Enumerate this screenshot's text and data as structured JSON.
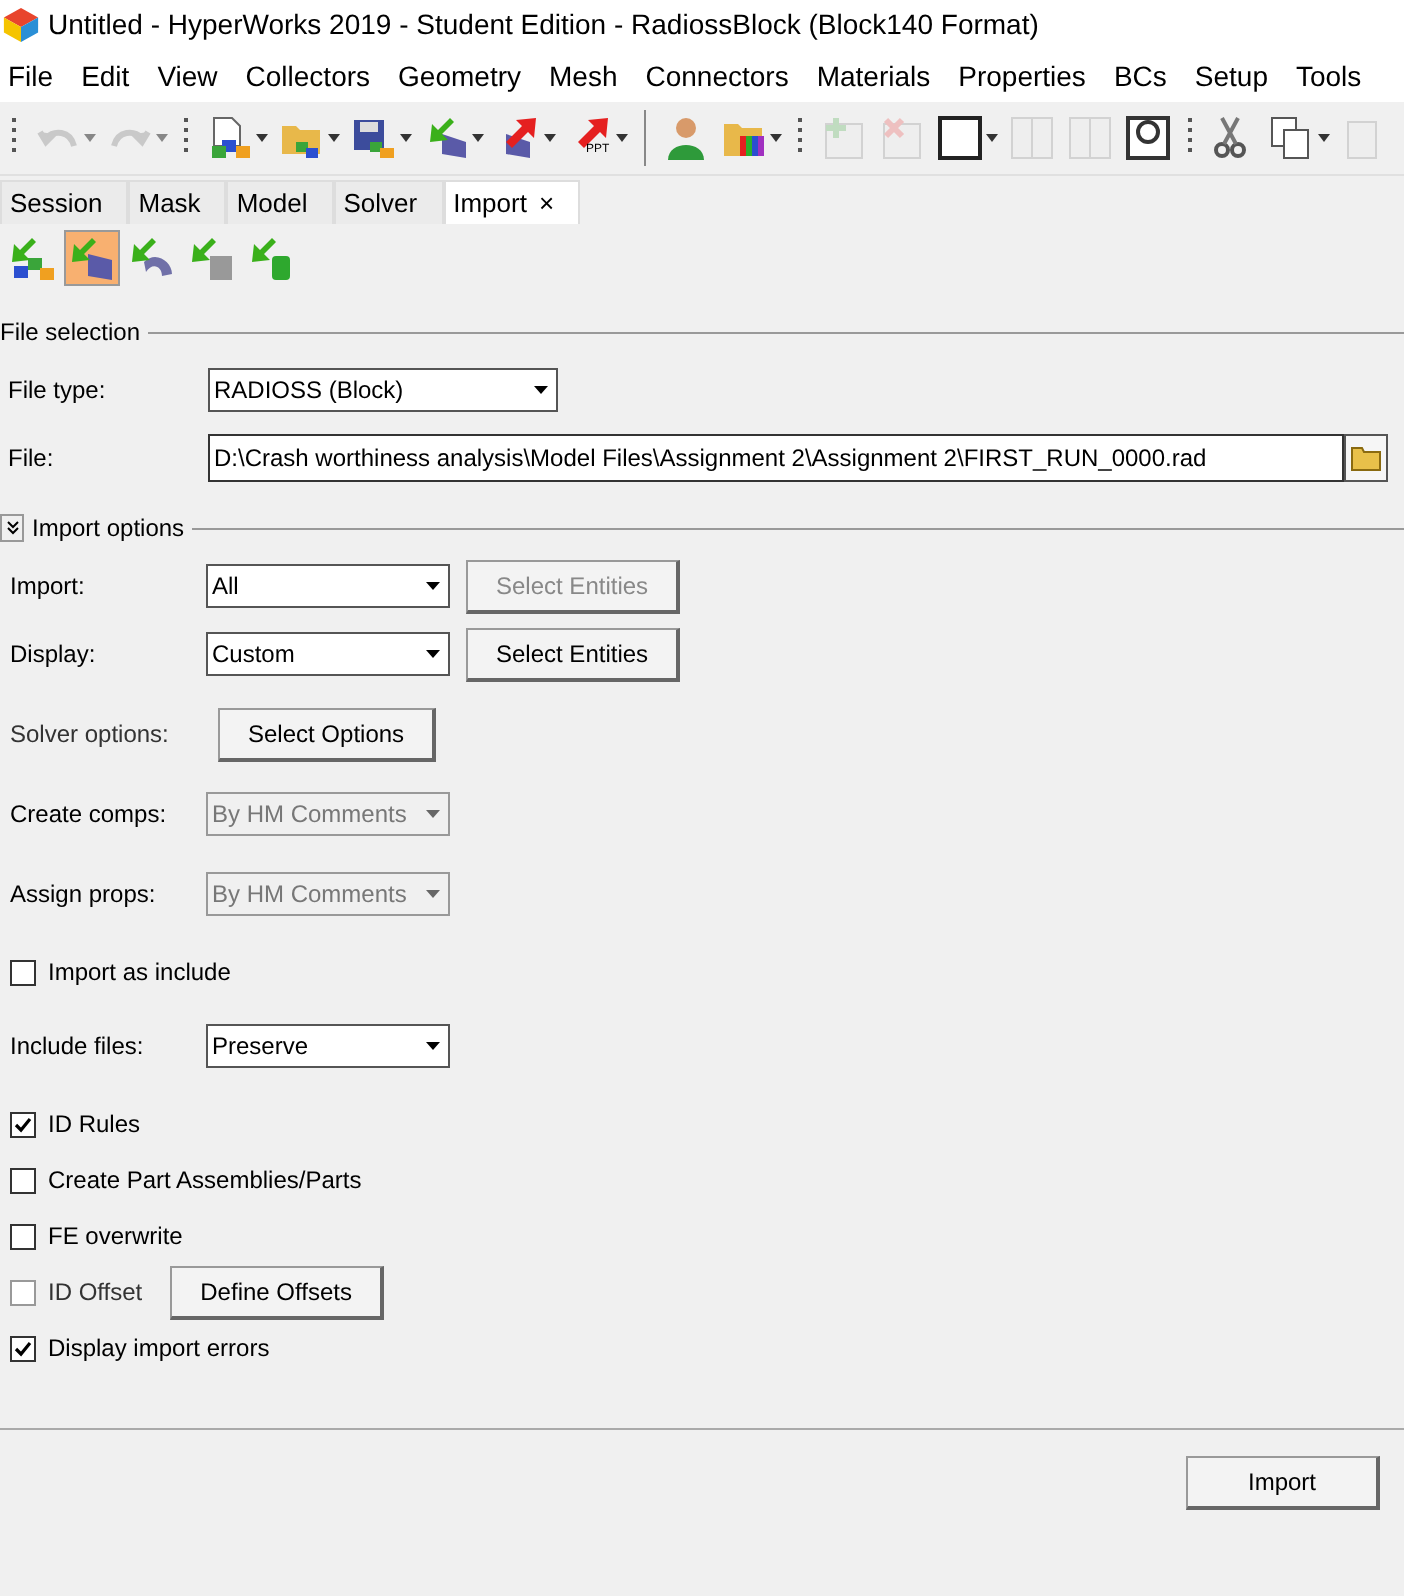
{
  "window": {
    "title": "Untitled - HyperWorks 2019 - Student Edition - RadiossBlock (Block140 Format)"
  },
  "menu": [
    "File",
    "Edit",
    "View",
    "Collectors",
    "Geometry",
    "Mesh",
    "Connectors",
    "Materials",
    "Properties",
    "BCs",
    "Setup",
    "Tools"
  ],
  "toolbar": [
    {
      "kind": "grip"
    },
    {
      "kind": "undo",
      "disabled": true,
      "dropdown": true
    },
    {
      "kind": "redo",
      "disabled": true,
      "dropdown": true
    },
    {
      "kind": "grip"
    },
    {
      "kind": "new",
      "disabled": false,
      "dropdown": true
    },
    {
      "kind": "open",
      "disabled": false,
      "dropdown": true
    },
    {
      "kind": "save",
      "disabled": false,
      "dropdown": true
    },
    {
      "kind": "import",
      "disabled": false,
      "dropdown": true
    },
    {
      "kind": "export",
      "disabled": false,
      "dropdown": true
    },
    {
      "kind": "export",
      "disabled": false,
      "dropdown": true,
      "label": "PPT"
    },
    {
      "kind": "divider"
    },
    {
      "kind": "user",
      "disabled": false,
      "dropdown": false
    },
    {
      "kind": "colors",
      "disabled": false,
      "dropdown": true
    },
    {
      "kind": "grip"
    },
    {
      "kind": "add",
      "disabled": true,
      "dropdown": false
    },
    {
      "kind": "delete",
      "disabled": true,
      "dropdown": false
    },
    {
      "kind": "frame",
      "disabled": false,
      "dropdown": true
    },
    {
      "kind": "pane",
      "disabled": true,
      "dropdown": false
    },
    {
      "kind": "pane",
      "disabled": true,
      "dropdown": false
    },
    {
      "kind": "help",
      "disabled": false,
      "dropdown": false
    },
    {
      "kind": "grip"
    },
    {
      "kind": "cut",
      "disabled": false,
      "dropdown": false
    },
    {
      "kind": "copy",
      "disabled": false,
      "dropdown": true
    },
    {
      "kind": "paste",
      "disabled": true,
      "dropdown": false
    }
  ],
  "tabs": [
    {
      "label": "Session",
      "selected": false
    },
    {
      "label": "Mask",
      "selected": false
    },
    {
      "label": "Model",
      "selected": false
    },
    {
      "label": "Solver",
      "selected": false
    },
    {
      "label": "Import",
      "selected": true,
      "close": "×"
    }
  ],
  "import_types": [
    {
      "kind": "model",
      "selected": false
    },
    {
      "kind": "mesh",
      "selected": true
    },
    {
      "kind": "surface",
      "selected": false
    },
    {
      "kind": "solid",
      "selected": false
    },
    {
      "kind": "cylinder",
      "selected": false
    }
  ],
  "file_selection": {
    "title": "File selection",
    "file_type": {
      "label": "File type:",
      "value": "RADIOSS (Block)"
    },
    "file": {
      "label": "File:",
      "value": "D:\\Crash worthiness analysis\\Model Files\\Assignment 2\\Assignment 2\\FIRST_RUN_0000.rad"
    }
  },
  "import_options": {
    "title": "Import options",
    "expanded": true,
    "rows": [
      {
        "kind": "select",
        "label": "Import:",
        "value": "All",
        "disabled": false,
        "button": {
          "label": "Select Entities",
          "disabled": true
        }
      },
      {
        "kind": "select",
        "label": "Display:",
        "value": "Custom",
        "disabled": false,
        "button": {
          "label": "Select Entities",
          "disabled": false
        }
      },
      {
        "kind": "button",
        "label": "Solver options:",
        "button": {
          "label": "Select Options",
          "disabled": false
        }
      },
      {
        "kind": "select",
        "label": "Create comps:",
        "value": "By HM Comments",
        "disabled": true
      },
      {
        "kind": "select",
        "label": "Assign props:",
        "value": "By HM Comments",
        "disabled": true
      },
      {
        "kind": "checkbox",
        "label": "Import as include",
        "checked": false,
        "disabled": false
      },
      {
        "kind": "select",
        "label": "Include files:",
        "value": "Preserve",
        "disabled": false
      },
      {
        "kind": "checkbox",
        "label": "ID Rules",
        "checked": true,
        "disabled": false
      },
      {
        "kind": "checkbox",
        "label": "Create Part Assemblies/Parts",
        "checked": false,
        "disabled": false
      },
      {
        "kind": "checkbox",
        "label": "FE overwrite",
        "checked": false,
        "disabled": false
      },
      {
        "kind": "checkbox",
        "label": "ID Offset",
        "checked": false,
        "disabled": true,
        "button": {
          "label": "Define Offsets",
          "disabled": false
        }
      },
      {
        "kind": "checkbox",
        "label": "Display import errors",
        "checked": true,
        "disabled": false
      }
    ]
  },
  "footer": {
    "button": "Import"
  }
}
